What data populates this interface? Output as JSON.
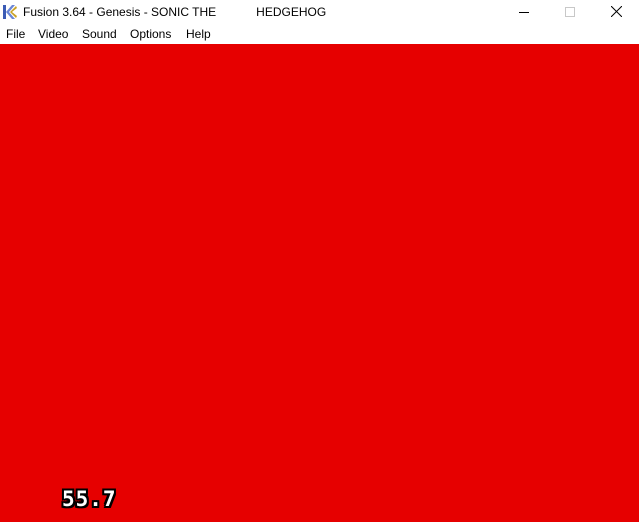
{
  "window": {
    "title": "Fusion 3.64 - Genesis - SONIC THE            HEDGEHOG",
    "app_icon": "fusion-icon",
    "controls": {
      "minimize_icon": "minimize-icon",
      "maximize_icon": "maximize-icon",
      "close_icon": "close-icon"
    }
  },
  "menu": {
    "items": [
      {
        "label": "File"
      },
      {
        "label": "Video"
      },
      {
        "label": "Sound"
      },
      {
        "label": "Options"
      },
      {
        "label": "Help"
      }
    ]
  },
  "viewport": {
    "background_color": "#e60000",
    "fps_counter": "55.7"
  }
}
